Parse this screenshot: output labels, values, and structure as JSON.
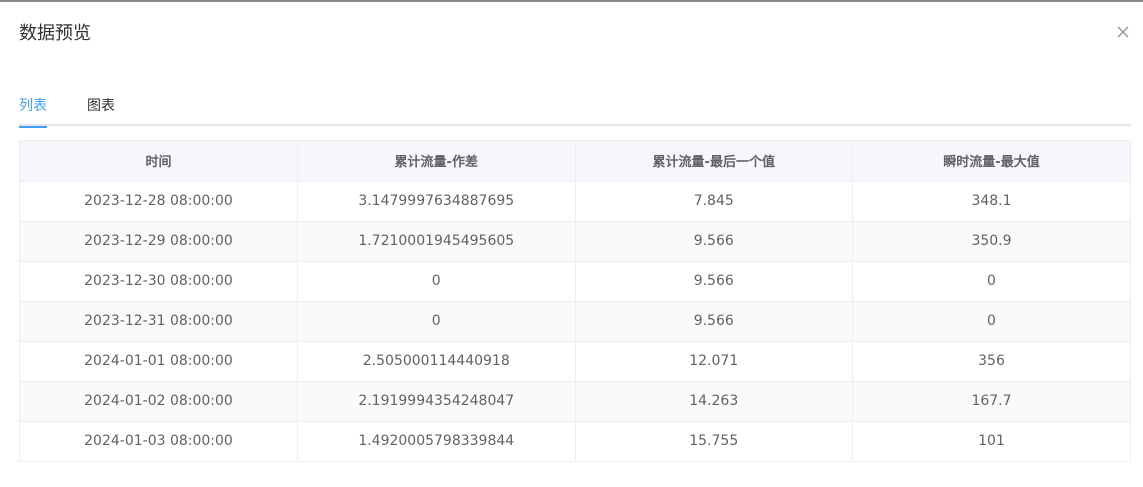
{
  "dialog": {
    "title": "数据预览",
    "close_icon": "close-icon"
  },
  "tabs": [
    {
      "label": "列表",
      "active": true
    },
    {
      "label": "图表",
      "active": false
    }
  ],
  "table": {
    "headers": [
      "时间",
      "累计流量-作差",
      "累计流量-最后一个值",
      "瞬时流量-最大值"
    ],
    "rows": [
      [
        "2023-12-28 08:00:00",
        "3.1479997634887695",
        "7.845",
        "348.1"
      ],
      [
        "2023-12-29 08:00:00",
        "1.7210001945495605",
        "9.566",
        "350.9"
      ],
      [
        "2023-12-30 08:00:00",
        "0",
        "9.566",
        "0"
      ],
      [
        "2023-12-31 08:00:00",
        "0",
        "9.566",
        "0"
      ],
      [
        "2024-01-01 08:00:00",
        "2.505000114440918",
        "12.071",
        "356"
      ],
      [
        "2024-01-02 08:00:00",
        "2.1919994354248047",
        "14.263",
        "167.7"
      ],
      [
        "2024-01-03 08:00:00",
        "1.4920005798339844",
        "15.755",
        "101"
      ]
    ]
  },
  "colors": {
    "accent": "#409eff",
    "header_bg": "#f5f7fa",
    "border": "#ebeef5",
    "stripe": "#fafafa"
  }
}
